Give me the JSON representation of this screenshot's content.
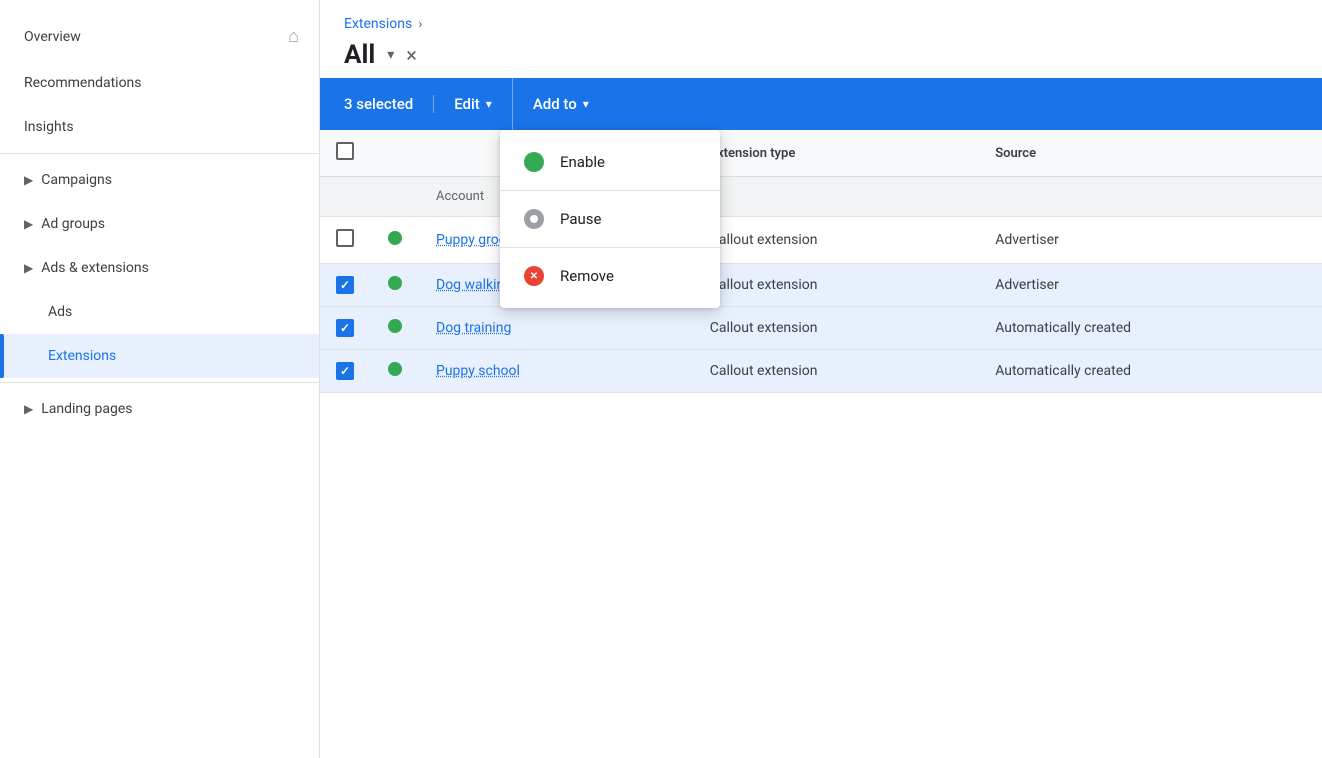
{
  "sidebar": {
    "items": [
      {
        "id": "overview",
        "label": "Overview",
        "hasHome": true,
        "hasChevron": false,
        "active": false,
        "isChild": false
      },
      {
        "id": "recommendations",
        "label": "Recommendations",
        "hasHome": false,
        "hasChevron": false,
        "active": false,
        "isChild": false
      },
      {
        "id": "insights",
        "label": "Insights",
        "hasHome": false,
        "hasChevron": false,
        "active": false,
        "isChild": false
      },
      {
        "id": "campaigns",
        "label": "Campaigns",
        "hasHome": false,
        "hasChevron": true,
        "active": false,
        "isChild": false
      },
      {
        "id": "adgroups",
        "label": "Ad groups",
        "hasHome": false,
        "hasChevron": true,
        "active": false,
        "isChild": false
      },
      {
        "id": "ads-extensions",
        "label": "Ads & extensions",
        "hasHome": false,
        "hasChevron": true,
        "active": false,
        "isChild": false
      },
      {
        "id": "ads",
        "label": "Ads",
        "hasHome": false,
        "hasChevron": false,
        "active": false,
        "isChild": true
      },
      {
        "id": "extensions",
        "label": "Extensions",
        "hasHome": false,
        "hasChevron": false,
        "active": true,
        "isChild": true
      },
      {
        "id": "landing-pages",
        "label": "Landing pages",
        "hasHome": false,
        "hasChevron": true,
        "active": false,
        "isChild": false
      }
    ]
  },
  "breadcrumb": {
    "text": "Extensions",
    "chevron": "›"
  },
  "header": {
    "title": "All",
    "close_label": "×"
  },
  "toolbar": {
    "selected_label": "3 selected",
    "edit_label": "Edit",
    "add_to_label": "Add to"
  },
  "dropdown_menu": {
    "items": [
      {
        "id": "enable",
        "label": "Enable",
        "status": "green"
      },
      {
        "id": "pause",
        "label": "Pause",
        "status": "gray"
      },
      {
        "id": "remove",
        "label": "Remove",
        "status": "red"
      }
    ]
  },
  "table": {
    "headers": [
      {
        "id": "checkbox",
        "label": ""
      },
      {
        "id": "status",
        "label": ""
      },
      {
        "id": "name",
        "label": ""
      },
      {
        "id": "ext_type",
        "label": "Extension type"
      },
      {
        "id": "source",
        "label": "Source"
      }
    ],
    "account_row_label": "Account",
    "rows": [
      {
        "id": 1,
        "checked": false,
        "status": "green",
        "name": "Puppy grooming",
        "ext_type": "Callout extension",
        "source": "Advertiser",
        "selected": false
      },
      {
        "id": 2,
        "checked": true,
        "status": "green",
        "name": "Dog walking",
        "ext_type": "Callout extension",
        "source": "Advertiser",
        "selected": true
      },
      {
        "id": 3,
        "checked": true,
        "status": "green",
        "name": "Dog training",
        "ext_type": "Callout extension",
        "source": "Automatically created",
        "selected": true
      },
      {
        "id": 4,
        "checked": true,
        "status": "green",
        "name": "Puppy school",
        "ext_type": "Callout extension",
        "source": "Automatically created",
        "selected": true
      }
    ]
  },
  "colors": {
    "blue": "#1a73e8",
    "green": "#34a853",
    "red": "#ea4335",
    "gray": "#9aa0a6"
  }
}
